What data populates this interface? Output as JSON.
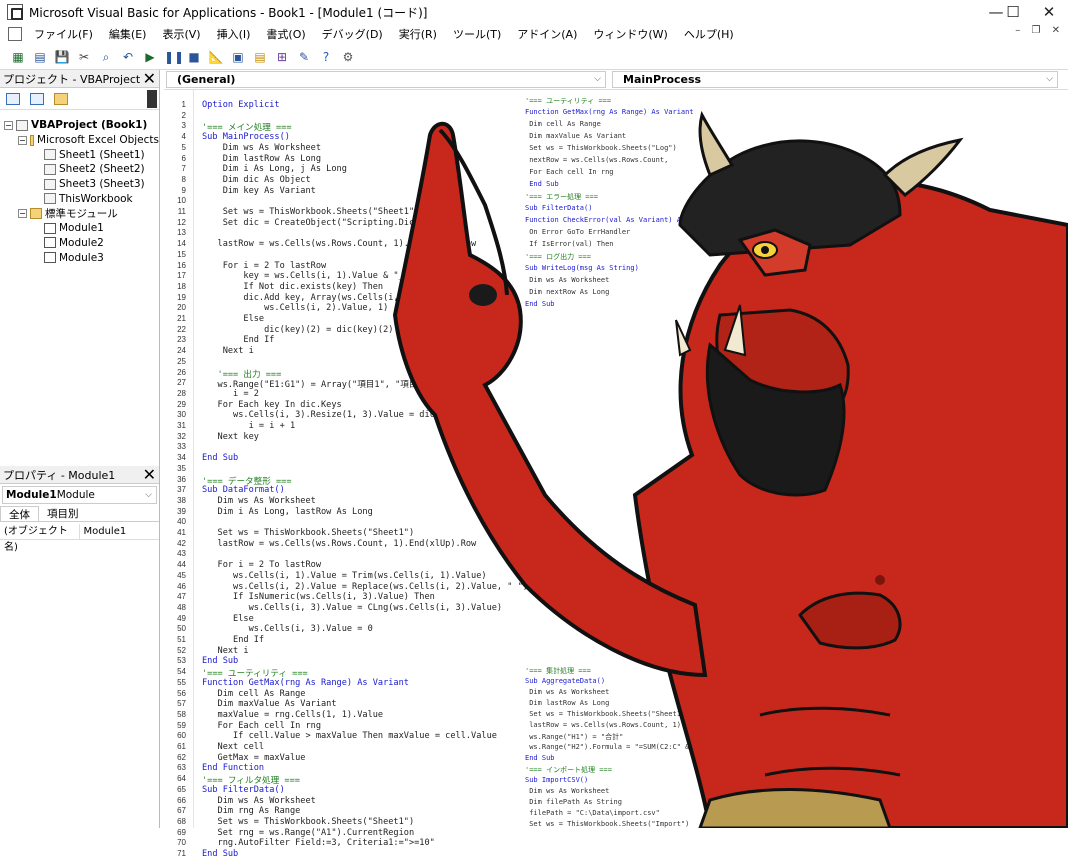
{
  "window": {
    "title": "Microsoft Visual Basic for Applications - Book1 - [Module1 (コード)]",
    "minimize": "—",
    "maximize": "☐",
    "close": "✕",
    "mdi_controls": "– ❐ ✕"
  },
  "menu": [
    "ファイル(F)",
    "編集(E)",
    "表示(V)",
    "挿入(I)",
    "書式(O)",
    "デバッグ(D)",
    "実行(R)",
    "ツール(T)",
    "アドイン(A)",
    "ウィンドウ(W)",
    "ヘルプ(H)"
  ],
  "toolbar_icons": [
    "excel-icon",
    "insert-icon",
    "save-icon",
    "cut-icon",
    "find-icon",
    "undo-icon",
    "run-icon",
    "pause-icon",
    "reset-icon",
    "design-icon",
    "project-icon",
    "properties-icon",
    "object-browser-icon",
    "toolbox-icon",
    "help-icon",
    "settings-icon"
  ],
  "project": {
    "title": "プロジェクト - VBAProject",
    "tree": [
      {
        "level": 0,
        "exp": "−",
        "icon": "vba",
        "label": "VBAProject (Book1)",
        "bold": true
      },
      {
        "level": 1,
        "exp": "−",
        "icon": "folder",
        "label": "Microsoft Excel Objects"
      },
      {
        "level": 2,
        "exp": "",
        "icon": "sheet",
        "label": "Sheet1 (Sheet1)"
      },
      {
        "level": 2,
        "exp": "",
        "icon": "sheet",
        "label": "Sheet2 (Sheet2)"
      },
      {
        "level": 2,
        "exp": "",
        "icon": "sheet",
        "label": "Sheet3 (Sheet3)"
      },
      {
        "level": 2,
        "exp": "",
        "icon": "sheet",
        "label": "ThisWorkbook"
      },
      {
        "level": 1,
        "exp": "−",
        "icon": "folder",
        "label": "標準モジュール"
      },
      {
        "level": 2,
        "exp": "",
        "icon": "mod",
        "label": "Module1"
      },
      {
        "level": 2,
        "exp": "",
        "icon": "mod",
        "label": "Module2"
      },
      {
        "level": 2,
        "exp": "",
        "icon": "mod",
        "label": "Module3"
      }
    ]
  },
  "properties": {
    "title": "プロパティ - Module1",
    "combo_bold": "Module1",
    "combo_rest": " Module",
    "tabs": [
      "全体",
      "項目別"
    ],
    "row_name": "(オブジェクト名)",
    "row_value": "Module1"
  },
  "code": {
    "object_combo": "(General)",
    "proc_combo": "MainProcess",
    "lines": [
      {
        "n": "1",
        "t": "Option Explicit",
        "c": "kw"
      },
      {
        "n": "2",
        "t": "",
        "c": ""
      },
      {
        "n": "3",
        "t": "'=== メイン処理 ===",
        "c": "cm"
      },
      {
        "n": "4",
        "t": "Sub MainProcess()",
        "c": "kw"
      },
      {
        "n": "5",
        "t": "    Dim ws As Worksheet",
        "c": ""
      },
      {
        "n": "6",
        "t": "    Dim lastRow As Long",
        "c": ""
      },
      {
        "n": "7",
        "t": "    Dim i As Long, j As Long",
        "c": ""
      },
      {
        "n": "8",
        "t": "    Dim dic As Object",
        "c": ""
      },
      {
        "n": "9",
        "t": "    Dim key As Variant",
        "c": ""
      },
      {
        "n": "10",
        "t": "",
        "c": ""
      },
      {
        "n": "11",
        "t": "    Set ws = ThisWorkbook.Sheets(\"Sheet1\")",
        "c": ""
      },
      {
        "n": "12",
        "t": "    Set dic = CreateObject(\"Scripting.Dictionary\")",
        "c": ""
      },
      {
        "n": "13",
        "t": "",
        "c": ""
      },
      {
        "n": "14",
        "t": "   lastRow = ws.Cells(ws.Rows.Count, 1).End(xlUp).Row",
        "c": ""
      },
      {
        "n": "15",
        "t": "",
        "c": ""
      },
      {
        "n": "16",
        "t": "    For i = 2 To lastRow",
        "c": ""
      },
      {
        "n": "17",
        "t": "        key = ws.Cells(i, 1).Value & \"_\" & ws.Cells(",
        "c": ""
      },
      {
        "n": "18",
        "t": "        If Not dic.exists(key) Then",
        "c": ""
      },
      {
        "n": "19",
        "t": "        dic.Add key, Array(ws.Cells(i, 1).Value",
        "c": ""
      },
      {
        "n": "20",
        "t": "            ws.Cells(i, 2).Value, 1)",
        "c": ""
      },
      {
        "n": "21",
        "t": "        Else",
        "c": ""
      },
      {
        "n": "22",
        "t": "            dic(key)(2) = dic(key)(2) + 1",
        "c": ""
      },
      {
        "n": "23",
        "t": "        End If",
        "c": ""
      },
      {
        "n": "24",
        "t": "    Next i",
        "c": ""
      },
      {
        "n": "25",
        "t": "",
        "c": ""
      },
      {
        "n": "26",
        "t": "   '=== 出力 ===",
        "c": "cm"
      },
      {
        "n": "27",
        "t": "   ws.Range(\"E1:G1\") = Array(\"項目1\", \"項目2\", \"件数\")",
        "c": ""
      },
      {
        "n": "28",
        "t": "      i = 2",
        "c": ""
      },
      {
        "n": "29",
        "t": "   For Each key In dic.Keys",
        "c": ""
      },
      {
        "n": "30",
        "t": "      ws.Cells(i, 3).Resize(1, 3).Value = dic(key)",
        "c": ""
      },
      {
        "n": "31",
        "t": "         i = i + 1",
        "c": ""
      },
      {
        "n": "32",
        "t": "   Next key",
        "c": ""
      },
      {
        "n": "33",
        "t": "",
        "c": ""
      },
      {
        "n": "34",
        "t": "End Sub",
        "c": "kw"
      },
      {
        "n": "35",
        "t": "",
        "c": ""
      },
      {
        "n": "36",
        "t": "'=== データ整形 ===",
        "c": "cm"
      },
      {
        "n": "37",
        "t": "Sub DataFormat()",
        "c": "kw"
      },
      {
        "n": "38",
        "t": "   Dim ws As Worksheet",
        "c": ""
      },
      {
        "n": "39",
        "t": "   Dim i As Long, lastRow As Long",
        "c": ""
      },
      {
        "n": "40",
        "t": "",
        "c": ""
      },
      {
        "n": "41",
        "t": "   Set ws = ThisWorkbook.Sheets(\"Sheet1\")",
        "c": ""
      },
      {
        "n": "42",
        "t": "   lastRow = ws.Cells(ws.Rows.Count, 1).End(xlUp).Row",
        "c": ""
      },
      {
        "n": "43",
        "t": "",
        "c": ""
      },
      {
        "n": "44",
        "t": "   For i = 2 To lastRow",
        "c": ""
      },
      {
        "n": "45",
        "t": "      ws.Cells(i, 1).Value = Trim(ws.Cells(i, 1).Value)",
        "c": ""
      },
      {
        "n": "46",
        "t": "      ws.Cells(i, 2).Value = Replace(ws.Cells(i, 2).Value, \" \", \" \")",
        "c": ""
      },
      {
        "n": "47",
        "t": "      If IsNumeric(ws.Cells(i, 3).Value) Then",
        "c": ""
      },
      {
        "n": "48",
        "t": "         ws.Cells(i, 3).Value = CLng(ws.Cells(i, 3).Value)",
        "c": ""
      },
      {
        "n": "49",
        "t": "      Else",
        "c": ""
      },
      {
        "n": "50",
        "t": "         ws.Cells(i, 3).Value = 0",
        "c": ""
      },
      {
        "n": "51",
        "t": "      End If",
        "c": ""
      },
      {
        "n": "52",
        "t": "   Next i",
        "c": ""
      },
      {
        "n": "53",
        "t": "End Sub",
        "c": "kw"
      },
      {
        "n": "54",
        "t": "'=== ユーティリティ ===",
        "c": "cm"
      },
      {
        "n": "55",
        "t": "Function GetMax(rng As Range) As Variant",
        "c": "kw"
      },
      {
        "n": "56",
        "t": "   Dim cell As Range",
        "c": ""
      },
      {
        "n": "57",
        "t": "   Dim maxValue As Variant",
        "c": ""
      },
      {
        "n": "58",
        "t": "   maxValue = rng.Cells(1, 1).Value",
        "c": ""
      },
      {
        "n": "59",
        "t": "   For Each cell In rng",
        "c": ""
      },
      {
        "n": "60",
        "t": "      If cell.Value > maxValue Then maxValue = cell.Value",
        "c": ""
      },
      {
        "n": "61",
        "t": "   Next cell",
        "c": ""
      },
      {
        "n": "62",
        "t": "   GetMax = maxValue",
        "c": ""
      },
      {
        "n": "63",
        "t": "End Function",
        "c": "kw"
      },
      {
        "n": "64",
        "t": "'=== フィルタ処理 ===",
        "c": "cm"
      },
      {
        "n": "65",
        "t": "Sub FilterData()",
        "c": "kw"
      },
      {
        "n": "66",
        "t": "   Dim ws As Worksheet",
        "c": ""
      },
      {
        "n": "67",
        "t": "   Dim rng As Range",
        "c": ""
      },
      {
        "n": "68",
        "t": "   Set ws = ThisWorkbook.Sheets(\"Sheet1\")",
        "c": ""
      },
      {
        "n": "69",
        "t": "   Set rng = ws.Range(\"A1\").CurrentRegion",
        "c": ""
      },
      {
        "n": "70",
        "t": "   rng.AutoFilter Field:=3, Criteria1:=\">=10\"",
        "c": ""
      },
      {
        "n": "71",
        "t": "End Sub",
        "c": "kw"
      }
    ],
    "gutter_numbers": [
      "1",
      "2",
      "3",
      "4",
      "5",
      "6",
      "7",
      "8",
      "9",
      "10",
      "11",
      "12",
      "13",
      "14",
      "15",
      "16",
      "17",
      "18",
      "19",
      "20",
      "21",
      "22",
      "23",
      "24",
      "25",
      "26",
      "27",
      "28",
      "29",
      "30",
      "31",
      "32",
      "33",
      "34",
      "35",
      "36",
      "37",
      "38",
      "39",
      "40",
      "41",
      "42",
      "43",
      "44",
      "45",
      "46",
      "47",
      "48",
      "49",
      "50",
      "51",
      "52",
      "53",
      "54",
      "55",
      "56",
      "57",
      "58",
      "59",
      "60",
      "61",
      "62",
      "63",
      "64",
      "65",
      "66",
      "67",
      "68",
      "69",
      "70",
      "71"
    ]
  },
  "right_code": [
    "'=== ユーティリティ ===",
    "Function GetMax(rng As Range) As Variant",
    " Dim cell As Range",
    " Dim maxValue As Variant",
    " Set ws = ThisWorkbook.Sheets(\"Log\")",
    " nextRow = ws.Cells(ws.Rows.Count,",
    " For Each cell In rng",
    " End Sub",
    "'=== エラー処理 ===",
    "Sub FilterData()",
    "Function CheckError(val As Variant) As",
    " On Error GoTo ErrHandler",
    " If IsError(val) Then",
    "'=== ログ出力 ===",
    "Sub WriteLog(msg As String)",
    " Dim ws As Worksheet",
    " Dim nextRow As Long",
    "End Sub",
    "'=== 集計処理 ===",
    "Sub AggregateData()",
    " Dim ws As Worksheet",
    " Dim lastRow As Long",
    " Set ws = ThisWorkbook.Sheets(\"Sheet1\")",
    " lastRow = ws.Cells(ws.Rows.Count, 1).End(xlUp).Row",
    " ws.Range(\"H1\") = \"合計\"",
    " ws.Range(\"H2\").Formula = \"=SUM(C2:C\" & lastRow & \")\"",
    "End Sub",
    "'=== インポート処理 ===",
    "Sub ImportCSV()",
    " Dim ws As Worksheet",
    " Dim filePath As String",
    " filePath = \"C:\\Data\\import.csv\"",
    " Set ws = ThisWorkbook.Sheets(\"Import\")"
  ]
}
